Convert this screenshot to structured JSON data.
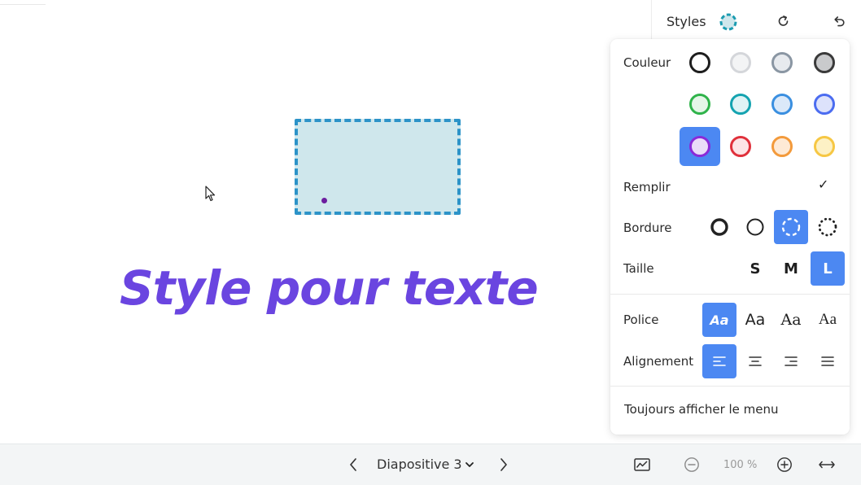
{
  "canvas": {
    "text": "Style pour texte",
    "text_color": "#6a45e0",
    "shape_fill": "#cfe7ec",
    "shape_border": "#2c93c8"
  },
  "header": {
    "title": "Styles",
    "icons": [
      "dashed-circle-icon",
      "redo-icon",
      "undo-icon"
    ]
  },
  "styles": {
    "color_label": "Couleur",
    "colors": [
      {
        "name": "black",
        "border": "#1d1d1d",
        "fill": "#ffffff"
      },
      {
        "name": "light-grey",
        "border": "#d4d6da",
        "fill": "#f3f4f5"
      },
      {
        "name": "grey",
        "border": "#8a96a3",
        "fill": "#e7eaee"
      },
      {
        "name": "dark-grey",
        "border": "#3a3a3a",
        "fill": "#c9cacc"
      },
      {
        "name": "green",
        "border": "#2fb34a",
        "fill": "#e5f6e8"
      },
      {
        "name": "teal",
        "border": "#14a3b0",
        "fill": "#dff3f5"
      },
      {
        "name": "blue",
        "border": "#3a8fe0",
        "fill": "#dbe9f9"
      },
      {
        "name": "indigo",
        "border": "#4b6cf0",
        "fill": "#dde2fb"
      },
      {
        "name": "violet",
        "border": "#8a2ad8",
        "fill": "#eadcf8",
        "selected": true
      },
      {
        "name": "red",
        "border": "#e0303b",
        "fill": "#fde4e6"
      },
      {
        "name": "orange",
        "border": "#f39a3b",
        "fill": "#feead6"
      },
      {
        "name": "yellow",
        "border": "#f6c744",
        "fill": "#fdf1c5"
      }
    ],
    "fill_label": "Remplir",
    "fill_checked": "✓",
    "border_label": "Bordure",
    "border_options": [
      "solid-thick",
      "solid-thin",
      "dashed",
      "dotted"
    ],
    "border_selected": "dashed",
    "size_label": "Taille",
    "sizes": [
      "S",
      "M",
      "L"
    ],
    "size_selected": "L",
    "font_label": "Police",
    "font_samples": [
      "Aa",
      "Aa",
      "Aa",
      "Aa"
    ],
    "font_selected": 0,
    "align_label": "Alignement",
    "align_options": [
      "align-left-icon",
      "align-center-icon",
      "align-right-icon",
      "align-justify-icon"
    ],
    "align_selected": "align-left-icon",
    "always_show_menu": "Toujours afficher le menu",
    "accent": "#4c88f2"
  },
  "bottombar": {
    "slide_label": "Diapositive 3",
    "zoom_text": "100 %"
  }
}
